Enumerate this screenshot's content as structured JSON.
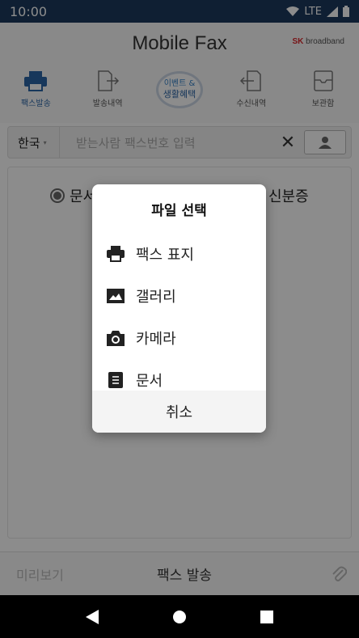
{
  "status": {
    "time": "10:00",
    "network": "LTE"
  },
  "header": {
    "title": "Mobile Fax",
    "brand_sk": "SK",
    "brand_rest": "broadband"
  },
  "nav": {
    "items": [
      {
        "label": "팩스발송",
        "icon": "fax-icon"
      },
      {
        "label": "발송내역",
        "icon": "send-history-icon"
      },
      {
        "label": "수신내역",
        "icon": "receive-history-icon"
      },
      {
        "label": "보관함",
        "icon": "archive-icon"
      }
    ],
    "event_line1": "이벤트 &",
    "event_line2": "생활혜택"
  },
  "search": {
    "country": "한국",
    "placeholder": "받는사람 팩스번호 입력"
  },
  "panel": {
    "radio_left": "문서",
    "radio_right": "신분증"
  },
  "bottom": {
    "preview": "미리보기",
    "send": "팩스 발송"
  },
  "dialog": {
    "title": "파일 선택",
    "options": [
      {
        "label": "팩스 표지",
        "icon": "fax-cover-icon"
      },
      {
        "label": "갤러리",
        "icon": "gallery-icon"
      },
      {
        "label": "카메라",
        "icon": "camera-icon"
      },
      {
        "label": "문서",
        "icon": "document-icon"
      }
    ],
    "cancel": "취소"
  },
  "colors": {
    "statusbar": "#1c3a5e",
    "accent": "#2a64a6",
    "brand": "#d9262b"
  }
}
